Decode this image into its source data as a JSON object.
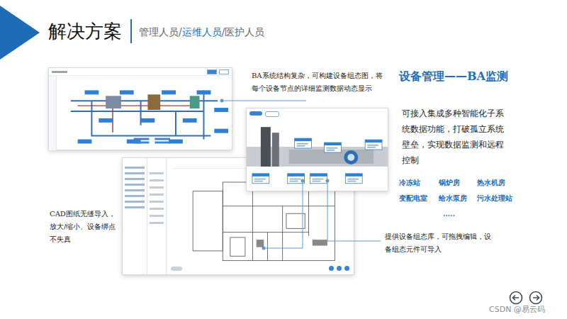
{
  "header": {
    "title": "解决方案",
    "separator": "/",
    "roles": [
      {
        "label": "管理人员",
        "selected": false
      },
      {
        "label": "运维人员",
        "selected": true
      },
      {
        "label": "医护人员",
        "selected": false
      }
    ]
  },
  "section": {
    "title": "设备管理——BA监测",
    "description": "可接入集成多种智能化子系统数据功能，打破孤立系统壁垒，实现数据监测和远程控制",
    "systems": [
      "冷冻站",
      "锅炉房",
      "热水机房",
      "变配电室",
      "给水泵房",
      "污水处理站"
    ],
    "more": "….."
  },
  "callouts": [
    {
      "text": "BA系统结构复杂，可构建设备组态图，将每个设备节点的详细监测数据动态显示"
    },
    {
      "text": "CAD图纸无缝导入，放大/缩小、设备绑点不失真"
    },
    {
      "text": "提供设备组态库，可拖拽编辑，设备组态元件可导入"
    }
  ],
  "watermark": "CSDN @易云码"
}
